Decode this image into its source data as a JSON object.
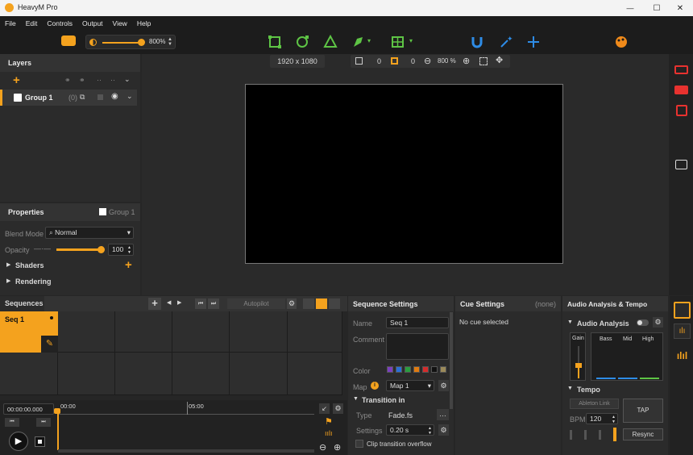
{
  "window": {
    "title": "HeavyM Pro",
    "minimize": "—",
    "maximize": "☐",
    "close": "✕"
  },
  "menu": [
    "File",
    "Edit",
    "Controls",
    "Output",
    "View",
    "Help"
  ],
  "toolbar": {
    "opacity_value": "800%"
  },
  "canvas": {
    "resolution": "1920 x 1080",
    "x_value": "0",
    "y_value": "0",
    "zoom": "800 %"
  },
  "layers": {
    "title": "Layers",
    "group_name": "Group 1",
    "group_count": "(0)"
  },
  "properties": {
    "title": "Properties",
    "group_label": "Group 1",
    "blend_mode_label": "Blend Mode",
    "blend_mode_value": "Normal",
    "opacity_label": "Opacity",
    "opacity_value": "100",
    "opacity_level": 1.0,
    "shaders_label": "Shaders",
    "rendering_label": "Rendering"
  },
  "sequences": {
    "tab": "Sequences",
    "autopilot": "Autopilot",
    "seq_name": "Seq 1",
    "timecode": "00:00:00.000",
    "tick_0": "00:00",
    "tick_1": "05:00"
  },
  "sequence_settings": {
    "title": "Sequence Settings",
    "name_label": "Name",
    "name_value": "Seq 1",
    "comment_label": "Comment",
    "color_label": "Color",
    "colors": [
      "#7b3fbf",
      "#2a6fd6",
      "#2a9d3f",
      "#e07b10",
      "#d42b2b",
      "#111111",
      "#9b8a5a"
    ],
    "map_label": "Map",
    "map_value": "Map 1",
    "transition_in": "Transition in",
    "type_label": "Type",
    "type_value": "Fade.fs",
    "settings_label": "Settings",
    "settings_value": "0.20 s",
    "clip_overflow": "Clip transition overflow"
  },
  "cue_settings": {
    "title": "Cue Settings",
    "none": "(none)",
    "empty": "No cue selected"
  },
  "audio": {
    "title": "Audio Analysis & Tempo",
    "analysis": "Audio Analysis",
    "gain": "Gain",
    "bass": "Bass",
    "mid": "Mid",
    "high": "High",
    "tempo": "Tempo",
    "ableton": "Ableton Link",
    "bpm_label": "BPM",
    "bpm_value": "120",
    "tap": "TAP",
    "resync": "Resync"
  },
  "colors": {
    "accent": "#f4a21e",
    "ui_blue": "#2e8ce6",
    "ui_green": "#5ec445",
    "ui_red": "#e8322f"
  }
}
